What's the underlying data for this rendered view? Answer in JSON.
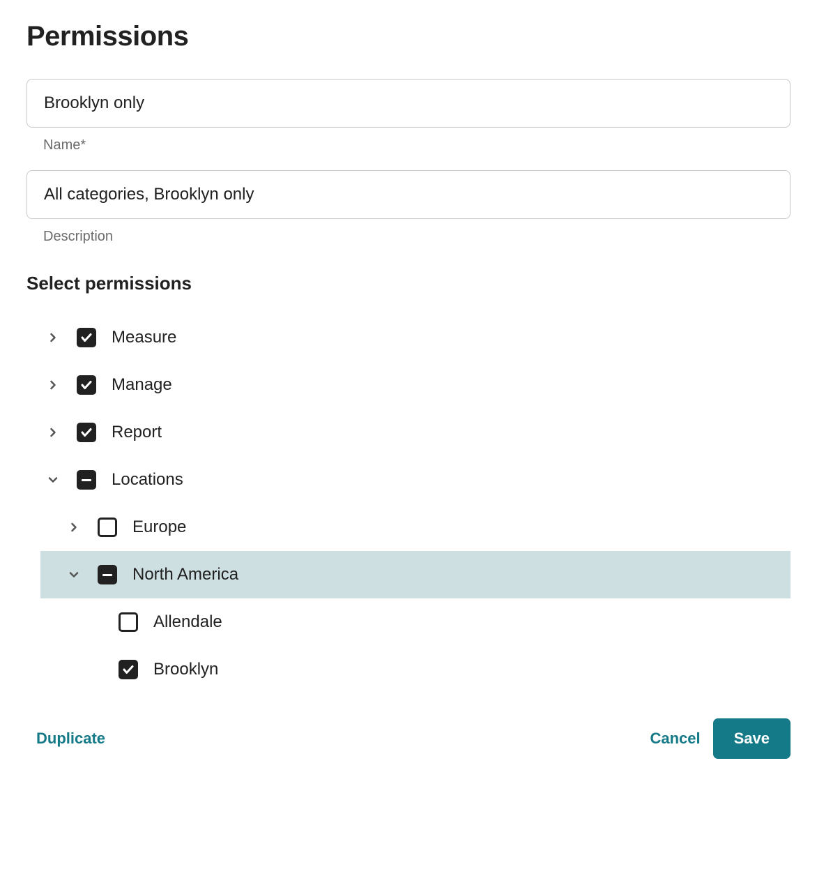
{
  "title": "Permissions",
  "fields": {
    "name": {
      "value": "Brooklyn only",
      "label": "Name*"
    },
    "description": {
      "value": "All categories, Brooklyn only",
      "label": "Description"
    }
  },
  "section_title": "Select permissions",
  "tree": {
    "measure": {
      "label": "Measure"
    },
    "manage": {
      "label": "Manage"
    },
    "report": {
      "label": "Report"
    },
    "locations": {
      "label": "Locations",
      "children": {
        "europe": {
          "label": "Europe"
        },
        "north_america": {
          "label": "North America",
          "children": {
            "allendale": {
              "label": "Allendale"
            },
            "brooklyn": {
              "label": "Brooklyn"
            }
          }
        }
      }
    }
  },
  "footer": {
    "duplicate": "Duplicate",
    "cancel": "Cancel",
    "save": "Save"
  }
}
